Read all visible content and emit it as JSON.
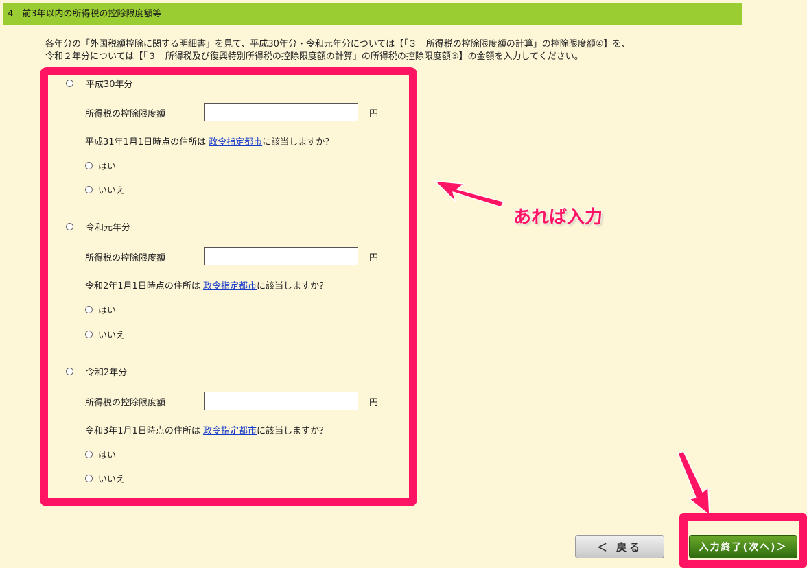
{
  "section": {
    "title": "4　前3年以内の所得税の控除限度額等"
  },
  "intro": {
    "line1": "各年分の「外国税額控除に関する明細書」を見て、平成30年分・令和元年分については【「３　所得税の控除限度額の計算」の控除限度額④】を、",
    "line2": "令和２年分については【「３　所得税及び復興特別所得税の控除限度額の計算」の所得税の控除限度額⑤】の金額を入力してください。"
  },
  "years": [
    {
      "title": "平成30年分",
      "amount_label": "所得税の控除限度額",
      "amount_value": "",
      "unit": "円",
      "question_prefix": "平成31年1月1日時点の住所は ",
      "question_link": "政令指定都市",
      "question_suffix": "に該当しますか？",
      "yes": "はい",
      "no": "いいえ"
    },
    {
      "title": "令和元年分",
      "amount_label": "所得税の控除限度額",
      "amount_value": "",
      "unit": "円",
      "question_prefix": "令和2年1月1日時点の住所は ",
      "question_link": "政令指定都市",
      "question_suffix": "に該当しますか？",
      "yes": "はい",
      "no": "いいえ"
    },
    {
      "title": "令和2年分",
      "amount_label": "所得税の控除限度額",
      "amount_value": "",
      "unit": "円",
      "question_prefix": "令和3年1月1日時点の住所は ",
      "question_link": "政令指定都市",
      "question_suffix": "に該当しますか？",
      "yes": "はい",
      "no": "いいえ"
    }
  ],
  "annotation": {
    "callout": "あれば入力",
    "color": "#ff1463"
  },
  "footer": {
    "back_label": "＜ 戻る",
    "next_label": "入力終了(次へ)＞"
  },
  "colors": {
    "header": "#9acd32",
    "background": "#fdf7d8",
    "next": "#3d7a18"
  }
}
